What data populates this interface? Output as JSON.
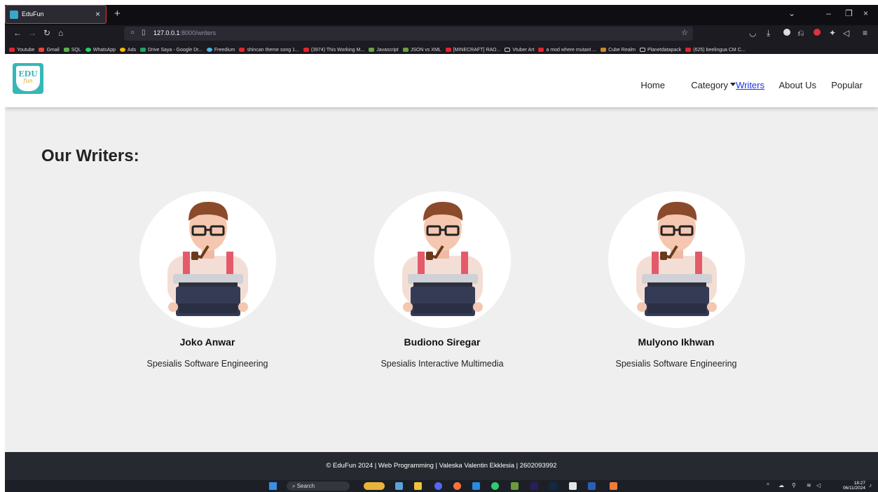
{
  "browser": {
    "tab_title": "EduFun",
    "url_host": "127.0.0.1",
    "url_path": ":8000/writers",
    "bookmarks": [
      "Youtube",
      "Gmail",
      "SQL",
      "WhatsApp",
      "Ads",
      "Drive Saya - Google Dr...",
      "Freedium",
      "shincan theme song 1...",
      "(3974) This Working M...",
      "Javascript",
      "JSON vs XML",
      "[MINECRAFT] RAO...",
      "Vtuber Art",
      "a mod where mutant ...",
      "Cube Realm",
      "Planetdatapack",
      "(625) beelingua CM C..."
    ]
  },
  "site": {
    "logo_top": "EDU",
    "logo_bottom": "fun",
    "nav": {
      "home": "Home",
      "category": "Category",
      "writers": "Writers",
      "about": "About Us",
      "popular": "Popular"
    },
    "heading": "Our Writers:",
    "writers": [
      {
        "name": "Joko Anwar",
        "role": "Spesialis Software Engineering"
      },
      {
        "name": "Budiono Siregar",
        "role": "Spesialis Interactive Multimedia"
      },
      {
        "name": "Mulyono Ikhwan",
        "role": "Spesialis Software Engineering"
      }
    ],
    "footer": "© EduFun 2024 | Web Programming | Valeska Valentin Ekklesia | 2602093992"
  },
  "taskbar": {
    "search_label": "Search",
    "time": "18:27",
    "date": "06/11/2024"
  },
  "colors": {
    "accent": "#36b7b8",
    "link_active": "#1e33e8",
    "page_bg": "#f0eff0",
    "footer_bg": "#26292f"
  }
}
